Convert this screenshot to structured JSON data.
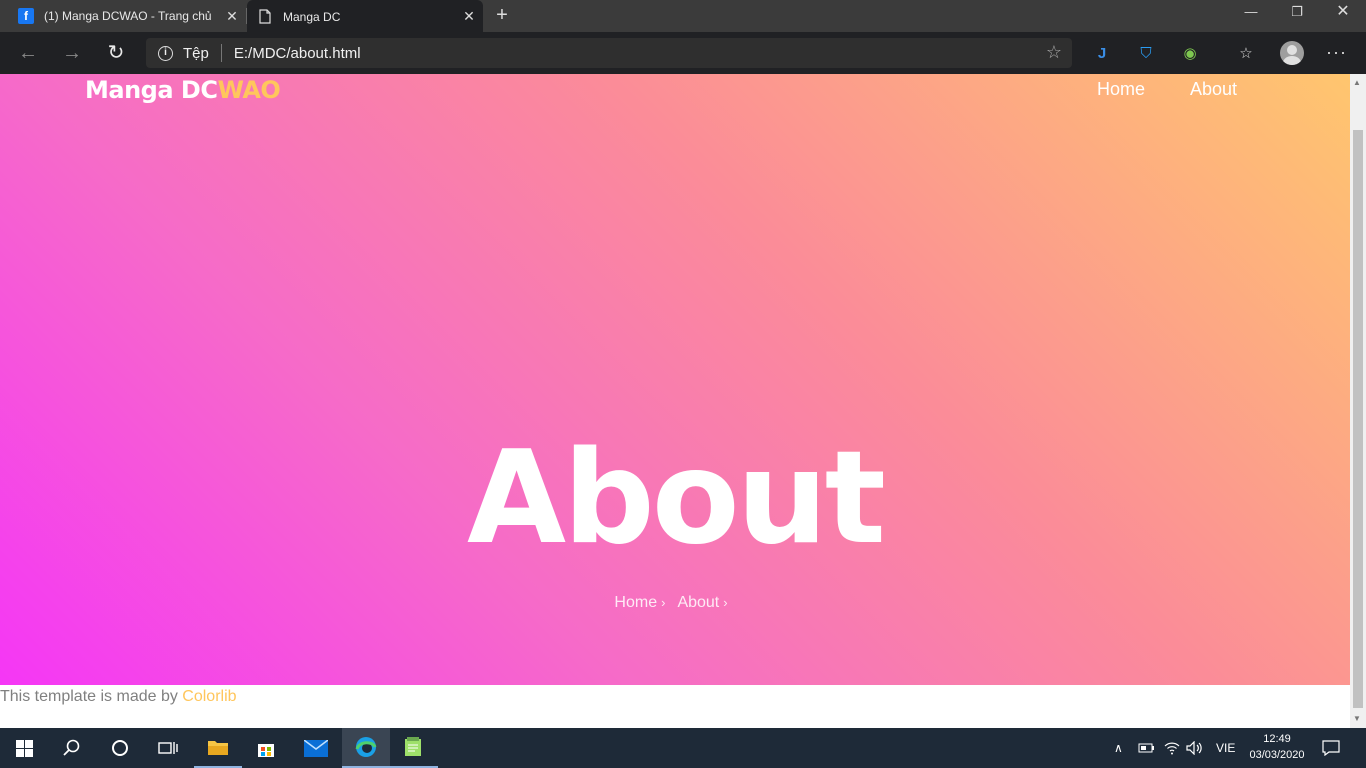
{
  "browser": {
    "tabs": [
      {
        "title": "(1) Manga DCWAO - Trang chủ",
        "favicon": "facebook-icon"
      },
      {
        "title": "Manga DC",
        "favicon": "page-icon"
      }
    ],
    "address": {
      "scheme_label": "Tệp",
      "url": "E:/MDC/about.html"
    }
  },
  "site": {
    "brand_main": "Manga DC",
    "brand_accent": "WAO",
    "nav": [
      {
        "label": "Home"
      },
      {
        "label": "About"
      }
    ],
    "hero_title": "About",
    "breadcrumbs": [
      {
        "label": "Home"
      },
      {
        "label": "About"
      }
    ],
    "footer_text": "This template is made by ",
    "footer_link": "Colorlib"
  },
  "colors": {
    "accent": "#ffc65c",
    "gradient": [
      "#ffc66e",
      "#fb8c98",
      "#f66bc8",
      "#f536f6"
    ]
  },
  "taskbar": {
    "language": "VIE",
    "time": "12:49",
    "date": "03/03/2020"
  }
}
